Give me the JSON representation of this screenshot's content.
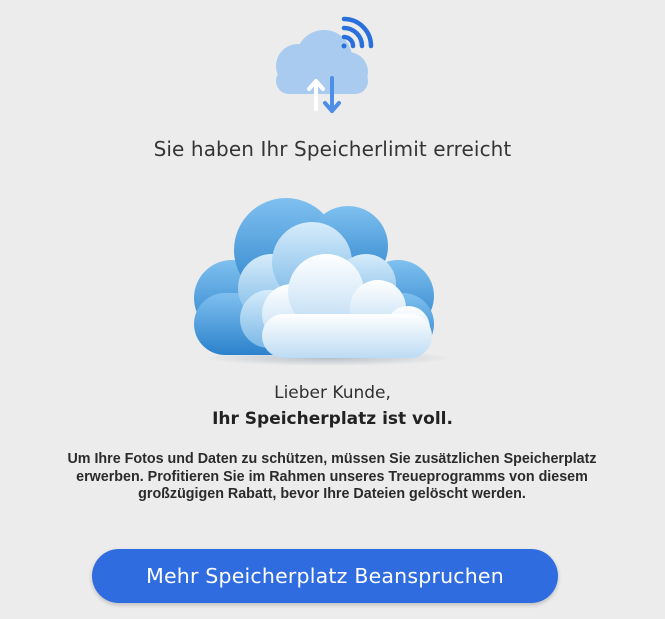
{
  "header": {
    "icon": "cloud-sync-wifi-icon",
    "headline": "Sie haben Ihr Speicherlimit erreicht"
  },
  "hero": {
    "icon": "clouds-illustration"
  },
  "message": {
    "greeting": "Lieber Kunde,",
    "status": "Ihr Speicherplatz ist voll.",
    "body_lines": [
      "Um Ihre Fotos und Daten zu schützen, müssen Sie zusätzlichen Speicherplatz",
      "erwerben. Profitieren Sie im Rahmen unseres Treueprogramms von diesem",
      "großzügigen Rabatt, bevor Ihre Dateien gelöscht werden."
    ]
  },
  "cta": {
    "label": "Mehr Speicherplatz Beanspruchen"
  },
  "colors": {
    "background": "#ececec",
    "button": "#2f6cdf",
    "icon_blue": "#2a70dc",
    "cloud_light": "#a9cbef"
  }
}
